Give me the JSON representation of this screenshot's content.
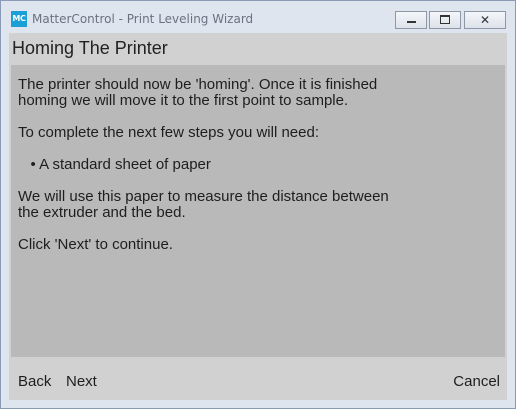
{
  "window": {
    "app_icon_text": "MC",
    "title": "MatterControl - Print Leveling Wizard",
    "minimize_glyph": "",
    "maximize_glyph": "",
    "close_glyph": "✕"
  },
  "page": {
    "title": "Homing The Printer",
    "paragraphs": [
      [
        "The printer should now be 'homing'. Once it is finished",
        "homing we will move it to the first point to sample."
      ],
      [
        "To complete the next few steps you will need:"
      ],
      [
        "   • A standard sheet of paper"
      ],
      [
        "We will use this paper to measure the distance between",
        "the extruder and the bed."
      ],
      [
        "Click 'Next' to continue."
      ]
    ]
  },
  "footer": {
    "back_label": "Back",
    "next_label": "Next",
    "cancel_label": "Cancel"
  },
  "colors": {
    "titlebar": "#dfe5ee",
    "client_bg": "#d1d1d1",
    "content_bg": "#b9b9b9",
    "app_icon": "#1a9fd6"
  }
}
